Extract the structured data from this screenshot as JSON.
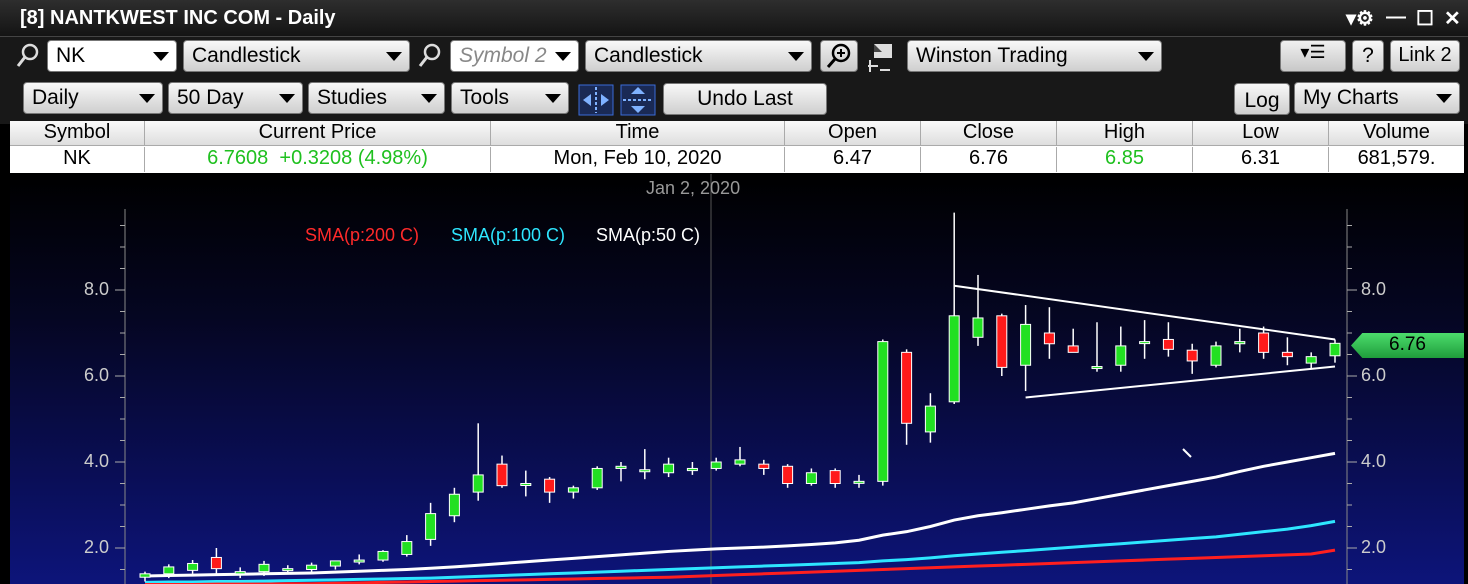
{
  "window": {
    "title": "[8] NANTKWEST INC COM - Daily"
  },
  "toolbar1": {
    "symbol_value": "NK",
    "chart_type_1": "Candlestick",
    "symbol2_placeholder": "Symbol 2",
    "chart_type_2": "Candlestick",
    "layout_name": "Winston Trading",
    "help_label": "?",
    "link_label": "Link 2"
  },
  "toolbar2": {
    "interval": "Daily",
    "period": "50 Day",
    "studies": "Studies",
    "tools": "Tools",
    "undo_label": "Undo Last",
    "log_label": "Log",
    "my_charts": "My Charts"
  },
  "quote_table": {
    "headers": [
      "Symbol",
      "Current Price",
      "Time",
      "Open",
      "Close",
      "High",
      "Low",
      "Volume"
    ],
    "row": {
      "symbol": "NK",
      "current_price": "6.7608  +0.3208 (4.98%)",
      "time": "Mon, Feb 10, 2020",
      "open": "6.47",
      "close": "6.76",
      "high": "6.85",
      "low": "6.31",
      "volume": "681,579."
    }
  },
  "chart_header": {
    "date_label": "Jan 2, 2020"
  },
  "legend": {
    "sma200": "SMA(p:200 C)",
    "sma100": "SMA(p:100 C)",
    "sma50": "SMA(p:50 C)"
  },
  "last_price_tag": "6.76",
  "colors": {
    "up": "#22e022",
    "down": "#ff1a1a",
    "sma200": "#ff1f1f",
    "sma100": "#2ee6ff",
    "sma50": "#ffffff"
  },
  "chart_data": {
    "type": "candlestick",
    "title": "",
    "ylim": [
      1.2,
      9.8
    ],
    "yticks": [
      "8.0",
      "6.0",
      "4.0",
      "2.0"
    ],
    "ytick_values": [
      8.0,
      6.0,
      4.0,
      2.0
    ],
    "candles": [
      {
        "o": 1.32,
        "h": 1.45,
        "l": 1.22,
        "c": 1.4
      },
      {
        "o": 1.4,
        "h": 1.62,
        "l": 1.3,
        "c": 1.56
      },
      {
        "o": 1.48,
        "h": 1.72,
        "l": 1.4,
        "c": 1.64
      },
      {
        "o": 1.78,
        "h": 2.0,
        "l": 1.35,
        "c": 1.52
      },
      {
        "o": 1.4,
        "h": 1.55,
        "l": 1.3,
        "c": 1.45
      },
      {
        "o": 1.45,
        "h": 1.7,
        "l": 1.35,
        "c": 1.62
      },
      {
        "o": 1.5,
        "h": 1.6,
        "l": 1.4,
        "c": 1.52
      },
      {
        "o": 1.5,
        "h": 1.66,
        "l": 1.45,
        "c": 1.6
      },
      {
        "o": 1.58,
        "h": 1.7,
        "l": 1.5,
        "c": 1.7
      },
      {
        "o": 1.68,
        "h": 1.85,
        "l": 1.62,
        "c": 1.72
      },
      {
        "o": 1.72,
        "h": 1.95,
        "l": 1.68,
        "c": 1.92
      },
      {
        "o": 1.85,
        "h": 2.3,
        "l": 1.8,
        "c": 2.15
      },
      {
        "o": 2.2,
        "h": 3.05,
        "l": 2.05,
        "c": 2.8
      },
      {
        "o": 2.75,
        "h": 3.4,
        "l": 2.6,
        "c": 3.25
      },
      {
        "o": 3.3,
        "h": 4.9,
        "l": 3.1,
        "c": 3.7
      },
      {
        "o": 3.95,
        "h": 4.15,
        "l": 3.4,
        "c": 3.45
      },
      {
        "o": 3.5,
        "h": 3.8,
        "l": 3.2,
        "c": 3.5
      },
      {
        "o": 3.6,
        "h": 3.65,
        "l": 3.05,
        "c": 3.3
      },
      {
        "o": 3.3,
        "h": 3.45,
        "l": 3.15,
        "c": 3.4
      },
      {
        "o": 3.4,
        "h": 3.9,
        "l": 3.35,
        "c": 3.85
      },
      {
        "o": 3.85,
        "h": 4.0,
        "l": 3.55,
        "c": 3.9
      },
      {
        "o": 3.8,
        "h": 4.3,
        "l": 3.6,
        "c": 3.82
      },
      {
        "o": 3.75,
        "h": 4.1,
        "l": 3.65,
        "c": 3.95
      },
      {
        "o": 3.8,
        "h": 4.0,
        "l": 3.7,
        "c": 3.85
      },
      {
        "o": 3.85,
        "h": 4.1,
        "l": 3.8,
        "c": 4.0
      },
      {
        "o": 3.95,
        "h": 4.35,
        "l": 3.9,
        "c": 4.05
      },
      {
        "o": 3.95,
        "h": 4.05,
        "l": 3.7,
        "c": 3.85
      },
      {
        "o": 3.9,
        "h": 3.95,
        "l": 3.4,
        "c": 3.5
      },
      {
        "o": 3.5,
        "h": 3.85,
        "l": 3.45,
        "c": 3.75
      },
      {
        "o": 3.8,
        "h": 3.85,
        "l": 3.4,
        "c": 3.5
      },
      {
        "o": 3.55,
        "h": 3.7,
        "l": 3.4,
        "c": 3.55
      },
      {
        "o": 3.55,
        "h": 6.85,
        "l": 3.45,
        "c": 6.8
      },
      {
        "o": 6.55,
        "h": 6.62,
        "l": 4.4,
        "c": 4.9
      },
      {
        "o": 4.7,
        "h": 5.6,
        "l": 4.45,
        "c": 5.3
      },
      {
        "o": 5.4,
        "h": 9.8,
        "l": 5.35,
        "c": 7.4
      },
      {
        "o": 6.9,
        "h": 8.35,
        "l": 6.7,
        "c": 7.35
      },
      {
        "o": 7.4,
        "h": 7.45,
        "l": 6.0,
        "c": 6.2
      },
      {
        "o": 6.25,
        "h": 7.65,
        "l": 5.65,
        "c": 7.2
      },
      {
        "o": 7.0,
        "h": 7.6,
        "l": 6.4,
        "c": 6.75
      },
      {
        "o": 6.7,
        "h": 7.1,
        "l": 6.55,
        "c": 6.55
      },
      {
        "o": 6.2,
        "h": 7.25,
        "l": 6.1,
        "c": 6.22
      },
      {
        "o": 6.25,
        "h": 7.15,
        "l": 6.1,
        "c": 6.7
      },
      {
        "o": 6.78,
        "h": 7.3,
        "l": 6.4,
        "c": 6.8
      },
      {
        "o": 6.85,
        "h": 7.25,
        "l": 6.45,
        "c": 6.62
      },
      {
        "o": 6.6,
        "h": 6.75,
        "l": 6.05,
        "c": 6.35
      },
      {
        "o": 6.25,
        "h": 6.8,
        "l": 6.2,
        "c": 6.7
      },
      {
        "o": 6.75,
        "h": 7.1,
        "l": 6.55,
        "c": 6.8
      },
      {
        "o": 7.0,
        "h": 7.15,
        "l": 6.4,
        "c": 6.55
      },
      {
        "o": 6.55,
        "h": 6.9,
        "l": 6.25,
        "c": 6.45
      },
      {
        "o": 6.3,
        "h": 6.55,
        "l": 6.15,
        "c": 6.45
      },
      {
        "o": 6.47,
        "h": 6.85,
        "l": 6.31,
        "c": 6.76
      }
    ],
    "series": [
      {
        "name": "SMA(p:50 C)",
        "values": [
          1.35,
          1.36,
          1.37,
          1.38,
          1.39,
          1.4,
          1.41,
          1.42,
          1.44,
          1.46,
          1.48,
          1.5,
          1.53,
          1.56,
          1.6,
          1.64,
          1.68,
          1.72,
          1.76,
          1.8,
          1.84,
          1.88,
          1.92,
          1.95,
          1.98,
          2.0,
          2.02,
          2.05,
          2.08,
          2.12,
          2.18,
          2.3,
          2.38,
          2.5,
          2.65,
          2.75,
          2.82,
          2.9,
          2.98,
          3.05,
          3.15,
          3.25,
          3.35,
          3.45,
          3.55,
          3.65,
          3.78,
          3.9,
          4.0,
          4.1,
          4.2
        ]
      },
      {
        "name": "SMA(p:100 C)",
        "values": [
          1.2,
          1.21,
          1.21,
          1.22,
          1.22,
          1.23,
          1.24,
          1.25,
          1.26,
          1.27,
          1.28,
          1.29,
          1.3,
          1.32,
          1.34,
          1.36,
          1.38,
          1.4,
          1.42,
          1.44,
          1.46,
          1.48,
          1.5,
          1.52,
          1.54,
          1.56,
          1.58,
          1.6,
          1.62,
          1.64,
          1.66,
          1.7,
          1.73,
          1.77,
          1.82,
          1.86,
          1.9,
          1.94,
          1.98,
          2.02,
          2.06,
          2.1,
          2.14,
          2.18,
          2.22,
          2.26,
          2.32,
          2.38,
          2.44,
          2.52,
          2.62
        ]
      },
      {
        "name": "SMA(p:200 C)",
        "values": [
          1.15,
          1.15,
          1.15,
          1.16,
          1.16,
          1.16,
          1.17,
          1.17,
          1.18,
          1.19,
          1.2,
          1.21,
          1.22,
          1.23,
          1.24,
          1.25,
          1.26,
          1.27,
          1.28,
          1.29,
          1.3,
          1.31,
          1.32,
          1.34,
          1.36,
          1.38,
          1.4,
          1.42,
          1.44,
          1.46,
          1.48,
          1.5,
          1.52,
          1.54,
          1.56,
          1.58,
          1.6,
          1.62,
          1.64,
          1.66,
          1.68,
          1.7,
          1.72,
          1.74,
          1.76,
          1.78,
          1.8,
          1.82,
          1.84,
          1.86,
          1.95
        ]
      }
    ],
    "trendlines": [
      {
        "from": [
          34,
          8.1
        ],
        "to": [
          50,
          6.85
        ]
      },
      {
        "from": [
          37,
          5.5
        ],
        "to": [
          50,
          6.22
        ]
      }
    ],
    "grid": true
  }
}
